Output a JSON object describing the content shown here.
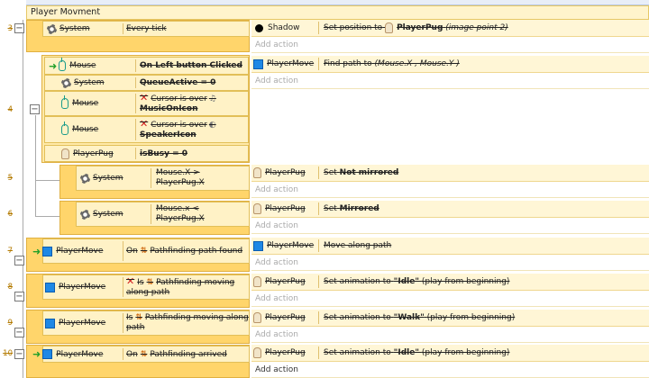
{
  "group": {
    "title": "Player Movment"
  },
  "events": [
    {
      "num": "3",
      "obj": "System",
      "cond": "Every tick",
      "act_obj": "Shadow",
      "act_pre": "Set position to",
      "act_target": "PlayerPug",
      "act_params": "(image point 2)",
      "add": "Add action"
    },
    {
      "num": "4",
      "conds": [
        {
          "obj": "Mouse",
          "text": "On Left button Clicked"
        },
        {
          "obj": "System",
          "text": "QueueActive = 0"
        },
        {
          "obj": "Mouse",
          "pre": "Cursor is over",
          "target": "MusicOnIcon"
        },
        {
          "obj": "Mouse",
          "pre": "Cursor is over",
          "target": "SpeakerIcon"
        },
        {
          "obj": "PlayerPug",
          "text": "isBusy = 0"
        }
      ],
      "act_obj": "PlayerMove",
      "act_pre": "Find path to",
      "act_params": "(Mouse.X , Mouse.Y )",
      "add": "Add action"
    },
    {
      "num": "5",
      "obj": "System",
      "cond": "Mouse.X > PlayerPug.X",
      "act_obj": "PlayerPug",
      "act_pre": "Set",
      "act_bold": "Not mirrored",
      "add": "Add action"
    },
    {
      "num": "6",
      "obj": "System",
      "cond": "Mouse.x < PlayerPug.X",
      "act_obj": "PlayerPug",
      "act_pre": "Set",
      "act_bold": "Mirrored",
      "add": "Add action"
    },
    {
      "num": "7",
      "obj": "PlayerMove",
      "cond": "Pathfinding path found",
      "cond_pre": "On",
      "act_obj": "PlayerMove",
      "act_pre": "Move along path",
      "add": "Add action"
    },
    {
      "num": "8",
      "obj": "PlayerMove",
      "cond": "Pathfinding moving along path",
      "cond_pre": "Is",
      "act_obj": "PlayerPug",
      "act_pre": "Set animation to",
      "act_bold": "\"Idle\"",
      "act_params": "(play from beginning)",
      "add": "Add action"
    },
    {
      "num": "9",
      "obj": "PlayerMove",
      "cond": "Pathfinding moving along path",
      "cond_pre": "Is",
      "act_obj": "PlayerPug",
      "act_pre": "Set animation to",
      "act_bold": "\"Walk\"",
      "act_params": "(play from beginning)",
      "add": "Add action"
    },
    {
      "num": "10",
      "obj": "PlayerMove",
      "cond": "Pathfinding arrived",
      "cond_pre": "On",
      "act_obj": "PlayerPug",
      "act_pre": "Set animation to",
      "act_bold": "\"Idle\"",
      "act_params": "(play from beginning)",
      "add": "Add action"
    }
  ],
  "colors": {
    "block": "#ffd56b",
    "condition": "#fff2c6",
    "strike_number": "#b37a00"
  }
}
